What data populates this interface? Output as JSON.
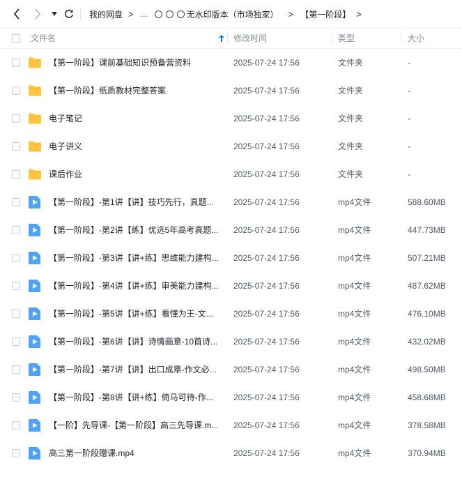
{
  "nav": {
    "breadcrumbs": [
      "我的网盘",
      "...",
      "无水印版本（市场独家）",
      "【第一阶段】"
    ]
  },
  "header": {
    "name": "文件名",
    "modified": "修改时间",
    "type": "类型",
    "size": "大小"
  },
  "files": [
    {
      "name": "【第一阶段】课前基础知识预备营资料",
      "modified": "2025-07-24 17:56",
      "type": "文件夹",
      "size": "-",
      "icon": "folder-icon"
    },
    {
      "name": "【第一阶段】纸质教材完整答案",
      "modified": "2025-07-24 17:56",
      "type": "文件夹",
      "size": "-",
      "icon": "folder-icon"
    },
    {
      "name": "电子笔记",
      "modified": "2025-07-24 17:56",
      "type": "文件夹",
      "size": "-",
      "icon": "folder-icon"
    },
    {
      "name": "电子讲义",
      "modified": "2025-07-24 17:56",
      "type": "文件夹",
      "size": "-",
      "icon": "folder-icon"
    },
    {
      "name": "课后作业",
      "modified": "2025-07-24 17:56",
      "type": "文件夹",
      "size": "-",
      "icon": "folder-icon"
    },
    {
      "name": "【第一阶段】-第1讲【讲】技巧先行，真题...",
      "modified": "2025-07-24 17:56",
      "type": "mp4文件",
      "size": "588.60MB",
      "icon": "video-file-icon"
    },
    {
      "name": "【第一阶段】-第2讲【练】优选5年高考真题...",
      "modified": "2025-07-24 17:56",
      "type": "mp4文件",
      "size": "447.73MB",
      "icon": "video-file-icon"
    },
    {
      "name": "【第一阶段】-第3讲【讲+练】思维能力建构...",
      "modified": "2025-07-24 17:56",
      "type": "mp4文件",
      "size": "507.21MB",
      "icon": "video-file-icon"
    },
    {
      "name": "【第一阶段】-第4讲【讲+练】审美能力建构...",
      "modified": "2025-07-24 17:56",
      "type": "mp4文件",
      "size": "487.62MB",
      "icon": "video-file-icon"
    },
    {
      "name": "【第一阶段】-第5讲【讲+练】看懂为王-文...",
      "modified": "2025-07-24 17:56",
      "type": "mp4文件",
      "size": "476.10MB",
      "icon": "video-file-icon"
    },
    {
      "name": "【第一阶段】-第6讲【讲】诗情画意-10首诗...",
      "modified": "2025-07-24 17:56",
      "type": "mp4文件",
      "size": "432.02MB",
      "icon": "video-file-icon"
    },
    {
      "name": "【第一阶段】-第7讲【讲】出口成章-作文必...",
      "modified": "2025-07-24 17:56",
      "type": "mp4文件",
      "size": "498.50MB",
      "icon": "video-file-icon"
    },
    {
      "name": "【第一阶段】-第8讲【讲+练】倚马可待-作...",
      "modified": "2025-07-24 17:56",
      "type": "mp4文件",
      "size": "458.68MB",
      "icon": "video-file-icon"
    },
    {
      "name": "【一阶】先导课-【第一阶段】高三先导课.m...",
      "modified": "2025-07-24 17:56",
      "type": "mp4文件",
      "size": "378.58MB",
      "icon": "video-file-icon"
    },
    {
      "name": "高三第一阶段赠课.mp4",
      "modified": "2025-07-24 17:56",
      "type": "mp4文件",
      "size": "370.94MB",
      "icon": "video-file-icon"
    }
  ],
  "colors": {
    "folder": "#FFC53D",
    "video": "#4DA3F7",
    "sort_arrow": "#1677ff"
  }
}
